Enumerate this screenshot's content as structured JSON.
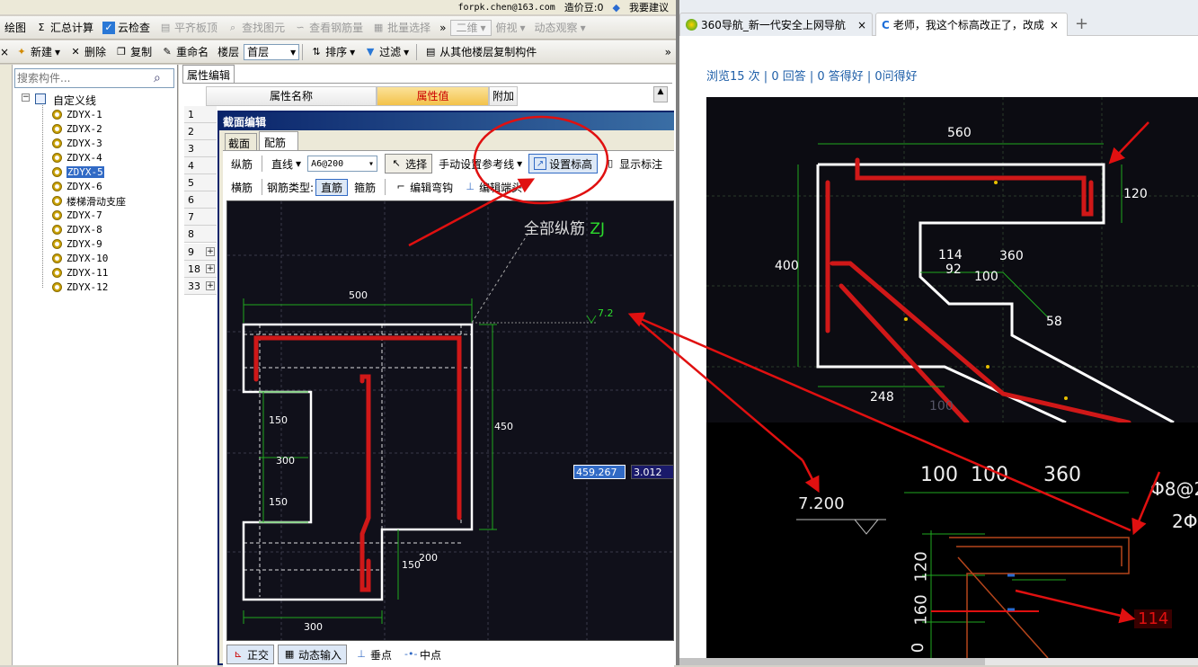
{
  "top_toolbar": {
    "items": [
      "绘图",
      "汇总计算",
      "云检查",
      "平齐板顶",
      "查找图元",
      "查看钢筋量",
      "批量选择",
      "二维",
      "俯视",
      "动态观察"
    ],
    "email": "forpk.chen@163.com",
    "price": "造价豆:0",
    "suggest": "我要建议"
  },
  "second_toolbar": {
    "new": "新建",
    "delete": "删除",
    "copy": "复制",
    "rename": "重命名",
    "floor_label": "楼层",
    "floor_value": "首层",
    "sort": "排序",
    "filter": "过滤",
    "copy_from": "从其他楼层复制构件"
  },
  "search": {
    "placeholder": "搜索构件..."
  },
  "tree": {
    "root": "自定义线",
    "items": [
      "ZDYX-1",
      "ZDYX-2",
      "ZDYX-3",
      "ZDYX-4",
      "ZDYX-5",
      "ZDYX-6",
      "楼梯滑动支座",
      "ZDYX-7",
      "ZDYX-8",
      "ZDYX-9",
      "ZDYX-10",
      "ZDYX-11",
      "ZDYX-12"
    ],
    "selected_index": 4
  },
  "property_panel": {
    "tab": "属性编辑",
    "columns": [
      "属性名称",
      "属性值",
      "附加"
    ],
    "row_numbers": [
      "1",
      "2",
      "3",
      "4",
      "5",
      "6",
      "7",
      "8",
      "9",
      "18",
      "33"
    ]
  },
  "dialog": {
    "title": "截面编辑",
    "tabs": [
      "截面",
      "配筋"
    ],
    "row1": {
      "zongjin": "纵筋",
      "line": "直线",
      "spec": "A6@200",
      "select": "选择",
      "manual": "手动设置参考线",
      "set_height": "设置标高",
      "show_label": "显示标注"
    },
    "row2": {
      "hengjin": "横筋",
      "type_label": "钢筋类型:",
      "zhijin": "直筋",
      "gujin": "箍筋",
      "edit_hook": "编辑弯钩",
      "edit_end": "编辑端头"
    },
    "canvas": {
      "caption": "全部纵筋",
      "caption_code": "ZJ",
      "dims": [
        "500",
        "450",
        "150",
        "300",
        "150",
        "200",
        "150",
        "300"
      ],
      "elevation": "7.2",
      "input1": "459.267",
      "input2": "3.012"
    },
    "status": {
      "ortho": "正交",
      "dyn": "动态输入",
      "perp": "垂点",
      "mid": "中点"
    }
  },
  "browser": {
    "tabs": [
      "360导航_新一代安全上网导航",
      "老师，我这个标高改正了，改成"
    ],
    "stats": "浏览15 次 | 0 回答 | 0 答得好 | 0问得好",
    "img1_dims": [
      "560",
      "120",
      "400",
      "114",
      "360",
      "92",
      "100",
      "58",
      "248",
      "100"
    ],
    "img2_dims": [
      "100",
      "100",
      "360",
      "7.200",
      "120",
      "160",
      "0",
      "114",
      "Φ8@2",
      "2Φ"
    ]
  },
  "colors": {
    "rebar": "#d01818",
    "arrow": "#e01010",
    "canvas": "#10101a",
    "dim_green": "#1fa81f",
    "selected": "#316ac5"
  }
}
